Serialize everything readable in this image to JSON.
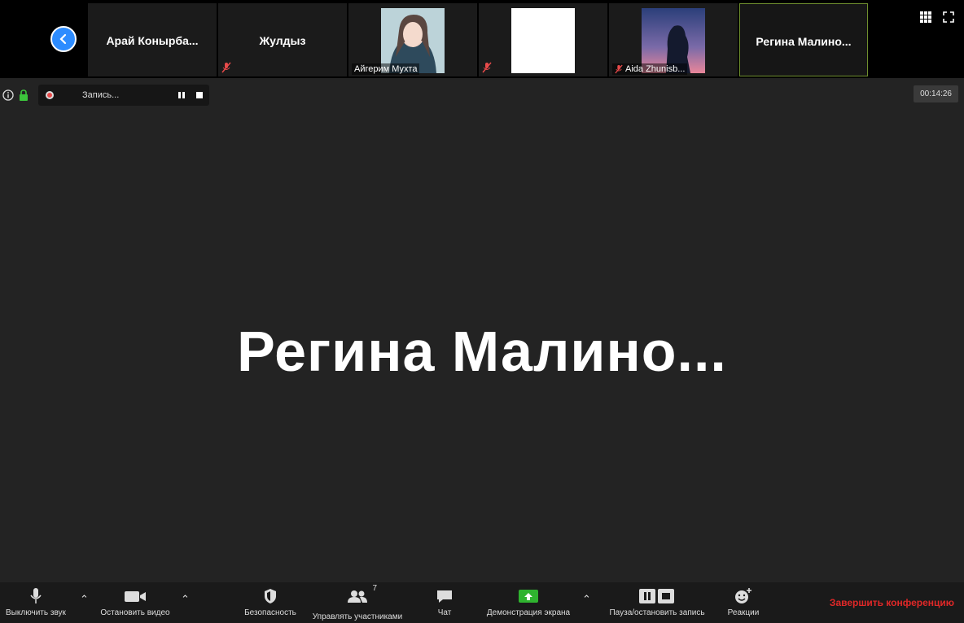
{
  "strip": {
    "tiles": [
      {
        "name": "Арай  Конырба..."
      },
      {
        "name": "Жулдыз"
      },
      {
        "name": "Айгерим Мухта"
      },
      {
        "name": ""
      },
      {
        "name": "Aida Zhunisb..."
      },
      {
        "name": "Регина  Малино..."
      }
    ]
  },
  "stage": {
    "recording_label": "Запись...",
    "timer": "00:14:26",
    "active_speaker": "Регина  Малино..."
  },
  "toolbar": {
    "mute": "Выключить звук",
    "video": "Остановить видео",
    "security": "Безопасность",
    "participants": "Управлять участниками",
    "participants_count": "7",
    "chat": "Чат",
    "share": "Демонстрация экрана",
    "record": "Пауза/остановить запись",
    "reactions": "Реакции",
    "end": "Завершить конференцию"
  },
  "colors": {
    "accent": "#2d8cff",
    "end": "#e02828",
    "share": "#2fb32f",
    "recording": "#e84a4a"
  }
}
